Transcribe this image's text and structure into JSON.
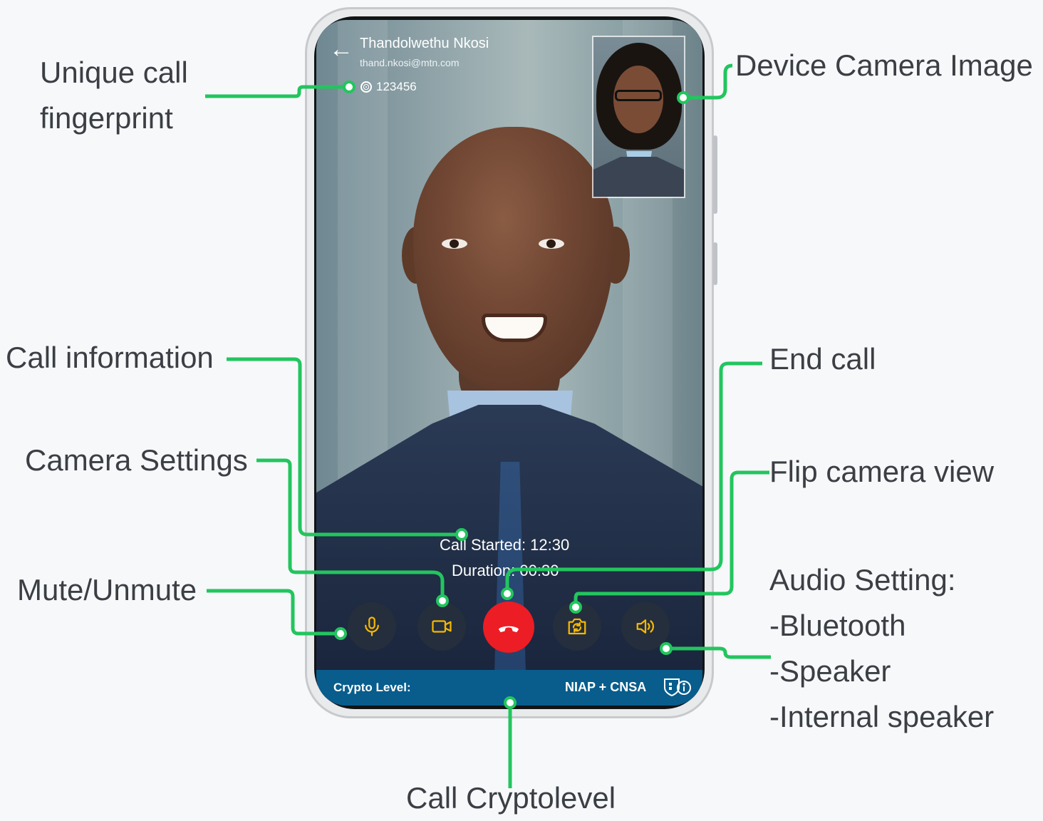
{
  "annotations": {
    "fingerprint_line1": "Unique call",
    "fingerprint_line2": "fingerprint",
    "camera_image": "Device Camera Image",
    "call_info": "Call information",
    "camera_settings": "Camera Settings",
    "mute": "Mute/Unmute",
    "end_call": "End call",
    "flip_camera": "Flip camera view",
    "audio_title": "Audio Setting:",
    "audio_bluetooth": "-Bluetooth",
    "audio_speaker": "-Speaker",
    "audio_internal": "-Internal speaker",
    "crypto": "Call Cryptolevel"
  },
  "call": {
    "contact_name": "Thandolwethu Nkosi",
    "contact_email": "thand.nkosi@mtn.com",
    "fingerprint_code": "123456",
    "call_started": "Call Started: 12:30",
    "duration": "Duration: 00:30",
    "crypto_label": "Crypto Level:",
    "crypto_value": "NIAP + CNSA"
  },
  "icons": {
    "back": "arrow-left",
    "fingerprint": "fingerprint",
    "mute": "microphone",
    "camera": "video-camera",
    "end": "phone-hangup",
    "flip": "camera-flip",
    "audio": "speaker",
    "crypto_info": "shield-info"
  },
  "colors": {
    "accent_line": "#22c55e",
    "icon_yellow": "#f5b800",
    "end_call": "#ec1d24",
    "crypto_bar": "#085d8c"
  }
}
